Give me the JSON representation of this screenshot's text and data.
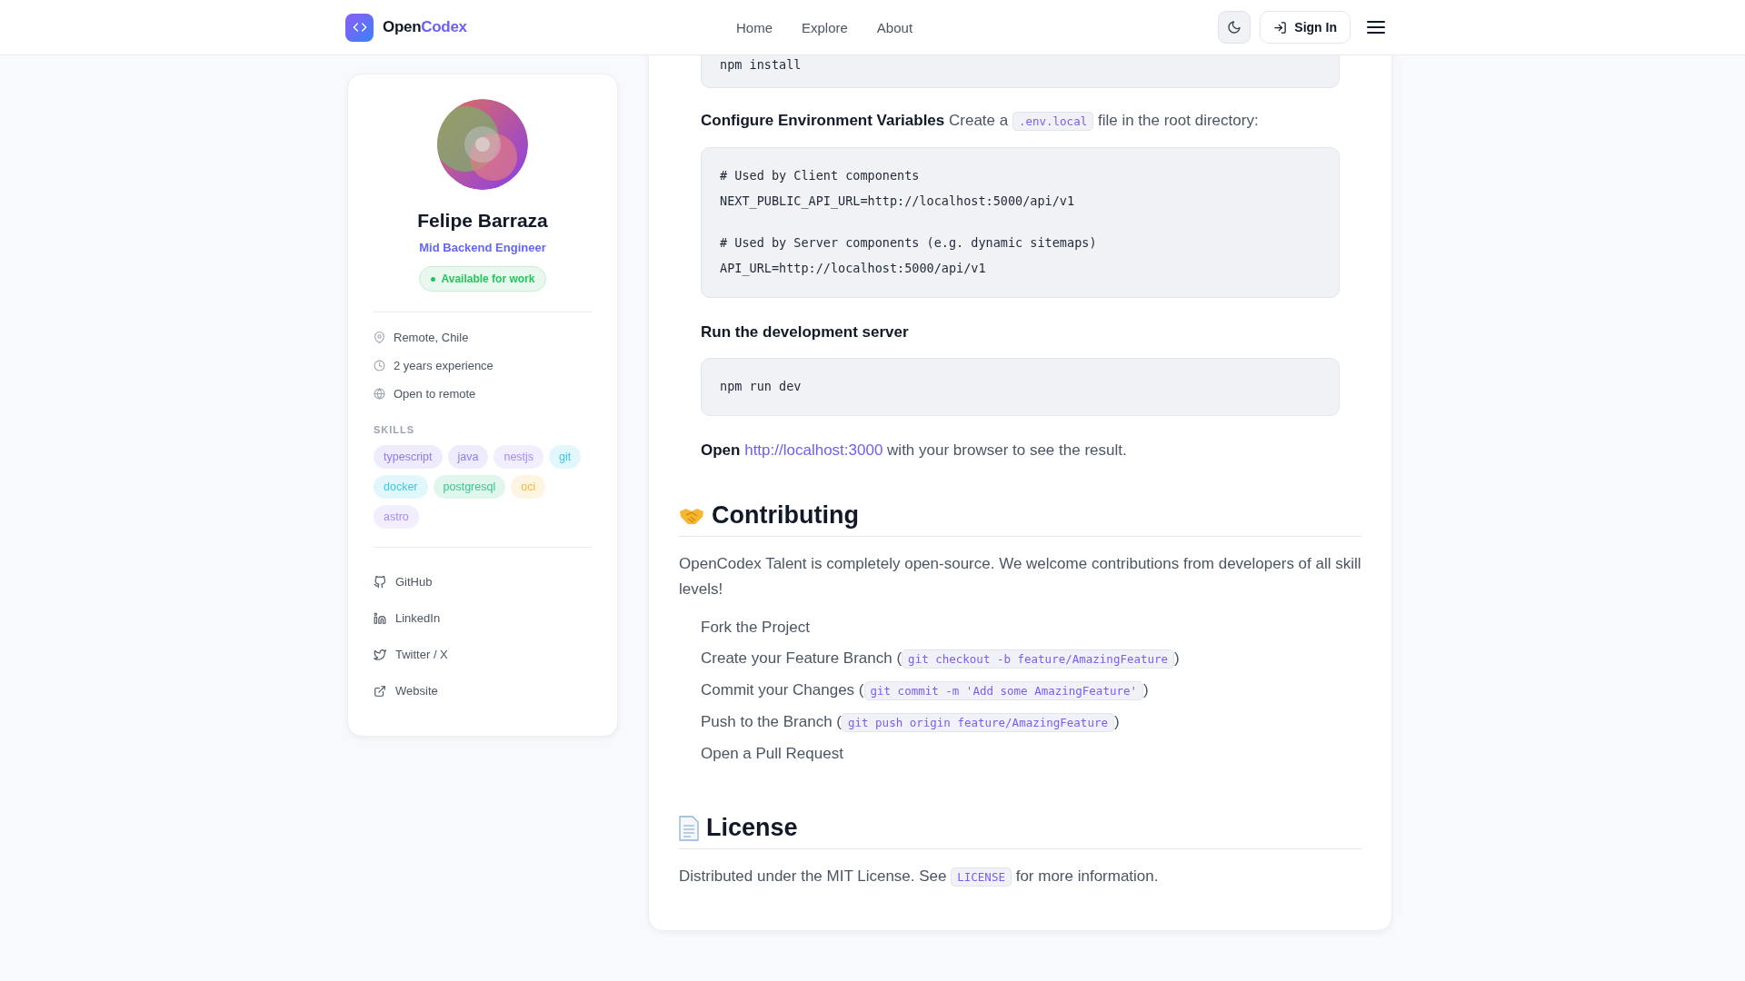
{
  "header": {
    "brand": {
      "first": "Open",
      "second": "Codex"
    },
    "nav": [
      {
        "label": "Home"
      },
      {
        "label": "Explore"
      },
      {
        "label": "About"
      }
    ],
    "sign_in": "Sign In"
  },
  "profile": {
    "name": "Felipe Barraza",
    "role": "Mid Backend Engineer",
    "status": "Available for work",
    "meta": [
      {
        "kind": "location",
        "text": "Remote, Chile"
      },
      {
        "kind": "experience",
        "text": "2 years experience"
      },
      {
        "kind": "remote",
        "text": "Open to remote"
      }
    ],
    "skills_title": "SKILLS",
    "skills": [
      {
        "label": "typescript",
        "color": "#8b7cf0"
      },
      {
        "label": "java",
        "color": "#8b7cf0"
      },
      {
        "label": "nestjs",
        "color": "#a78bfa"
      },
      {
        "label": "git",
        "color": "#38c9e8"
      },
      {
        "label": "docker",
        "color": "#38c9e8"
      },
      {
        "label": "postgresql",
        "color": "#34c98e"
      },
      {
        "label": "oci",
        "color": "#f5b83d"
      },
      {
        "label": "astro",
        "color": "#a78bfa"
      }
    ],
    "links": [
      {
        "kind": "github",
        "label": "GitHub"
      },
      {
        "kind": "linkedin",
        "label": "LinkedIn"
      },
      {
        "kind": "twitter",
        "label": "Twitter / X"
      },
      {
        "kind": "website",
        "label": "Website"
      }
    ]
  },
  "readme": {
    "blocks": [
      {
        "kind": "code",
        "groups": [
          [
            "npm install"
          ]
        ]
      },
      {
        "kind": "step",
        "segments": [
          {
            "kind": "text",
            "text": "**Configure Environment Variables** Create a "
          },
          {
            "kind": "code",
            "text": ".env.local"
          },
          {
            "kind": "text",
            "text": " file in the root directory:"
          }
        ]
      },
      {
        "kind": "code",
        "groups": [
          [
            "# Used by Client components",
            "NEXT_PUBLIC_API_URL=http://localhost:5000/api/v1"
          ],
          [
            "# Used by Server components (e.g. dynamic sitemaps)",
            "API_URL=http://localhost:5000/api/v1"
          ]
        ]
      },
      {
        "kind": "step",
        "segments": [
          {
            "kind": "text",
            "text": "**Run the development server**"
          }
        ]
      },
      {
        "kind": "code",
        "groups": [
          [
            "npm run dev"
          ]
        ]
      },
      {
        "kind": "step",
        "segments": [
          {
            "kind": "text",
            "text": "**Open** "
          },
          {
            "kind": "link",
            "text": "http://localhost:3000"
          },
          {
            "kind": "text",
            "text": " with your browser to see the result."
          }
        ]
      },
      {
        "kind": "heading",
        "text": "Contributing"
      },
      {
        "kind": "para",
        "segments": [
          {
            "kind": "text",
            "text": "OpenCodex Talent is completely open-source. We welcome contributions from developers of all skill levels!"
          }
        ]
      },
      {
        "kind": "list",
        "items": [
          [
            {
              "kind": "text",
              "text": "Fork the Project"
            }
          ],
          [
            {
              "kind": "text",
              "text": "Create your Feature Branch ("
            },
            {
              "kind": "code",
              "text": "git checkout -b feature/AmazingFeature"
            },
            {
              "kind": "text",
              "text": ")"
            }
          ],
          [
            {
              "kind": "text",
              "text": "Commit your Changes ("
            },
            {
              "kind": "code",
              "text": "git commit -m 'Add some AmazingFeature'"
            },
            {
              "kind": "text",
              "text": ")"
            }
          ],
          [
            {
              "kind": "text",
              "text": "Push to the Branch ("
            },
            {
              "kind": "code",
              "text": "git push origin feature/AmazingFeature"
            },
            {
              "kind": "text",
              "text": ")"
            }
          ],
          [
            {
              "kind": "text",
              "text": "Open a Pull Request"
            }
          ]
        ]
      },
      {
        "kind": "heading",
        "text": "License"
      },
      {
        "kind": "para",
        "segments": [
          {
            "kind": "text",
            "text": "Distributed under the MIT License. See "
          },
          {
            "kind": "code",
            "text": "LICENSE"
          },
          {
            "kind": "text",
            "text": " for more information."
          }
        ]
      }
    ]
  }
}
